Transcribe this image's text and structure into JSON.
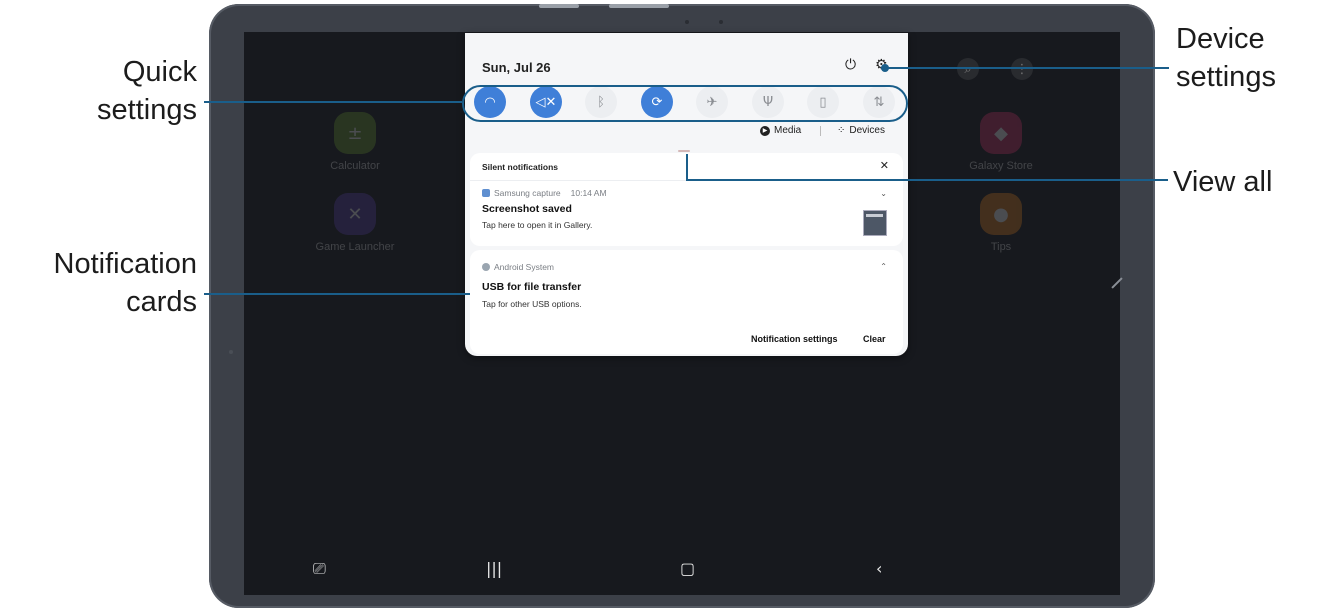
{
  "callouts": {
    "quick_settings_l1": "Quick",
    "quick_settings_l2": "settings",
    "notification_cards_l1": "Notification",
    "notification_cards_l2": "cards",
    "device_settings_l1": "Device",
    "device_settings_l2": "settings",
    "view_all": "View all"
  },
  "home_apps": [
    {
      "label": "Calculator",
      "icon": "calculator-icon"
    },
    {
      "label": "Game Launcher",
      "icon": "game-launcher-icon"
    },
    {
      "label": "Galaxy Store",
      "icon": "shopping-bag-icon"
    },
    {
      "label": "Tips",
      "icon": "lightbulb-icon"
    }
  ],
  "panel": {
    "date": "Sun, Jul 26",
    "quick_toggles": [
      {
        "name": "wifi",
        "icon": "wifi-icon",
        "state": "on"
      },
      {
        "name": "sound",
        "icon": "mute-icon",
        "state": "on"
      },
      {
        "name": "bluetooth",
        "icon": "bluetooth-icon",
        "state": "off"
      },
      {
        "name": "auto-rotate",
        "icon": "rotate-icon",
        "state": "on"
      },
      {
        "name": "airplane",
        "icon": "airplane-icon",
        "state": "off"
      },
      {
        "name": "flashlight",
        "icon": "flashlight-icon",
        "state": "off"
      },
      {
        "name": "battery",
        "icon": "battery-icon",
        "state": "off"
      },
      {
        "name": "mobile-data",
        "icon": "data-arrows-icon",
        "state": "off"
      }
    ],
    "media_label": "Media",
    "devices_label": "Devices",
    "silent_notifications": "Silent notifications",
    "notifications": [
      {
        "app": "Samsung capture",
        "time": "10:14 AM",
        "title": "Screenshot saved",
        "body": "Tap here to open it in Gallery."
      },
      {
        "app": "Android System",
        "time": "",
        "title": "USB for file transfer",
        "body": "Tap for other USB options."
      }
    ],
    "notification_settings_label": "Notification settings",
    "clear_label": "Clear"
  },
  "colors": {
    "accent": "#3f7fd8",
    "callout_line": "#1a5e8a",
    "tablet_frame": "#3c4048",
    "screen": "#17191e"
  }
}
